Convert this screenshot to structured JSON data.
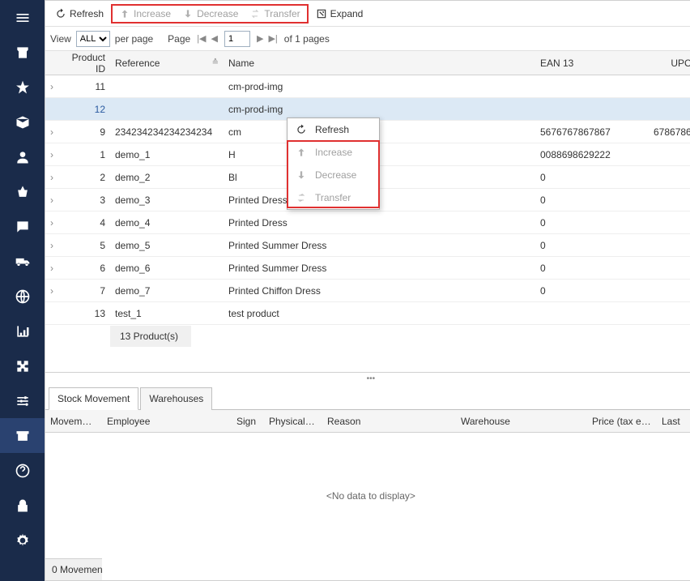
{
  "toolbar": {
    "refresh": "Refresh",
    "increase": "Increase",
    "decrease": "Decrease",
    "transfer": "Transfer",
    "expand": "Expand"
  },
  "pager": {
    "view": "View",
    "all": "ALL",
    "per_page": "per page",
    "page": "Page",
    "page_num": "1",
    "of_pages": "of 1 pages"
  },
  "columns": {
    "product_id": "Product ID",
    "reference": "Reference",
    "name": "Name",
    "ean13": "EAN 13",
    "upc": "UPC"
  },
  "rows": [
    {
      "id": "11",
      "ref": "",
      "name": "cm-prod-img",
      "ean": "",
      "upc": ""
    },
    {
      "id": "12",
      "ref": "",
      "name": "cm-prod-img",
      "ean": "",
      "upc": "",
      "selected": true,
      "noexp": true
    },
    {
      "id": "9",
      "ref": "234234234234234234",
      "name": "cm",
      "ean": "5676767867867",
      "upc": "6786786"
    },
    {
      "id": "1",
      "ref": "demo_1",
      "name": "H",
      "ean": "0088698629222",
      "upc": ""
    },
    {
      "id": "2",
      "ref": "demo_2",
      "name": "Bl",
      "ean": "0",
      "upc": ""
    },
    {
      "id": "3",
      "ref": "demo_3",
      "name": "Printed Dress",
      "ean": "0",
      "upc": ""
    },
    {
      "id": "4",
      "ref": "demo_4",
      "name": "Printed Dress",
      "ean": "0",
      "upc": ""
    },
    {
      "id": "5",
      "ref": "demo_5",
      "name": "Printed Summer Dress",
      "ean": "0",
      "upc": ""
    },
    {
      "id": "6",
      "ref": "demo_6",
      "name": "Printed Summer Dress",
      "ean": "0",
      "upc": ""
    },
    {
      "id": "7",
      "ref": "demo_7",
      "name": "Printed Chiffon Dress",
      "ean": "0",
      "upc": ""
    },
    {
      "id": "13",
      "ref": "test_1",
      "name": "test product",
      "ean": "",
      "upc": "",
      "noexp": true
    }
  ],
  "footer": {
    "count": "13 Product(s)"
  },
  "ctx": {
    "refresh": "Refresh",
    "increase": "Increase",
    "decrease": "Decrease",
    "transfer": "Transfer"
  },
  "tabs": {
    "sm": "Stock Movement",
    "wh": "Warehouses"
  },
  "subcols": {
    "movement": "Movement I",
    "employee": "Employee",
    "sign": "Sign",
    "physical": "Physical Qu",
    "reason": "Reason",
    "warehouse": "Warehouse",
    "price": "Price (tax excl.",
    "last": "Last"
  },
  "no_data": "<No data to display>",
  "sub_footer": "0 Movemen"
}
